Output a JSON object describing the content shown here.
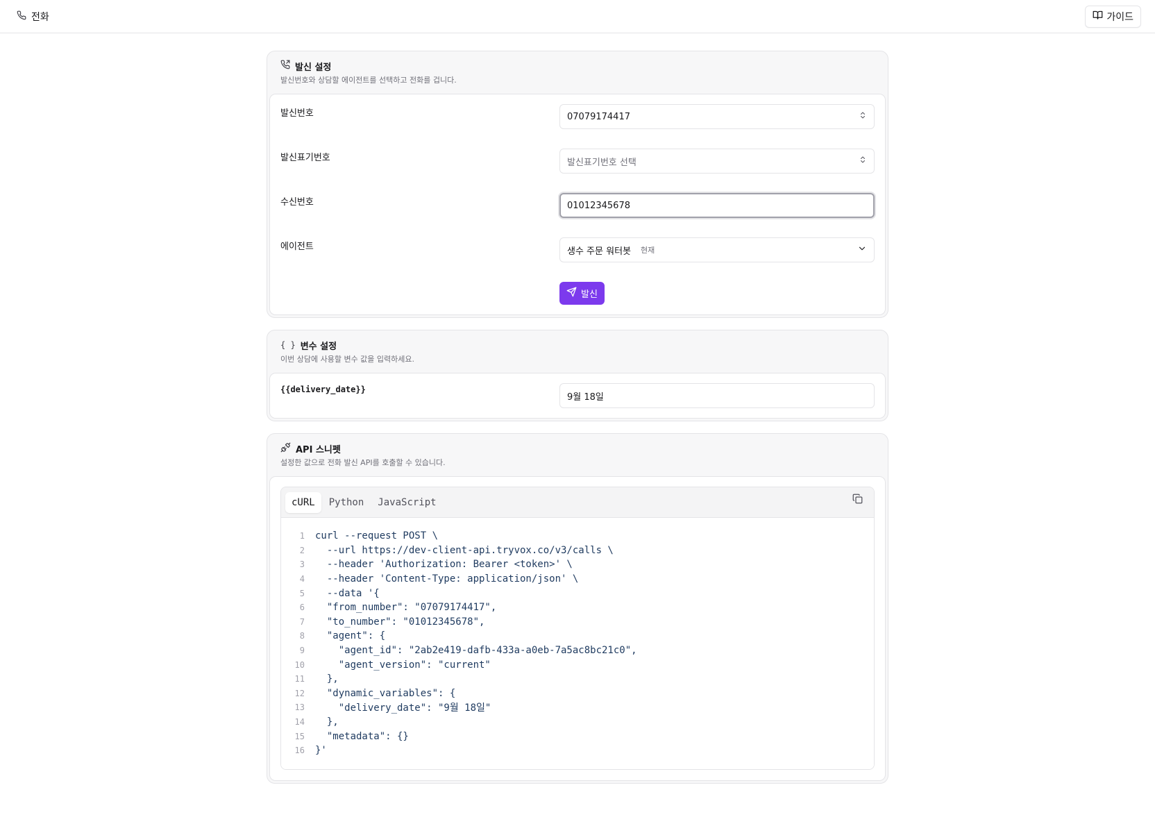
{
  "header": {
    "title": "전화",
    "guide_label": "가이드"
  },
  "outbound": {
    "title": "발신 설정",
    "description": "발신번호와 상담할 에이전트를 선택하고 전화를 겁니다.",
    "fields": {
      "caller_number": {
        "label": "발신번호",
        "value": "07079174417"
      },
      "display_number": {
        "label": "발신표기번호",
        "placeholder": "발신표기번호 선택"
      },
      "recipient_number": {
        "label": "수신번호",
        "value": "01012345678"
      },
      "agent": {
        "label": "에이전트",
        "value": "생수 주문 워터봇",
        "tag": "현재"
      }
    },
    "send_label": "발신"
  },
  "variables": {
    "title": "변수 설정",
    "icon_text": "{ }",
    "description": "이번 상담에 사용할 변수 값을 입력하세요.",
    "items": [
      {
        "name": "{{delivery_date}}",
        "value": "9월 18일"
      }
    ]
  },
  "api": {
    "title": "API 스니펫",
    "description": "설정한 값으로 전화 발신 API를 호출할 수 있습니다.",
    "tabs": [
      "cURL",
      "Python",
      "JavaScript"
    ],
    "active_tab": "cURL",
    "code_lines": [
      "curl --request POST \\",
      "  --url https://dev-client-api.tryvox.co/v3/calls \\",
      "  --header 'Authorization: Bearer <token>' \\",
      "  --header 'Content-Type: application/json' \\",
      "  --data '{",
      "  \"from_number\": \"07079174417\",",
      "  \"to_number\": \"01012345678\",",
      "  \"agent\": {",
      "    \"agent_id\": \"2ab2e419-dafb-433a-a0eb-7a5ac8bc21c0\",",
      "    \"agent_version\": \"current\"",
      "  },",
      "  \"dynamic_variables\": {",
      "    \"delivery_date\": \"9월 18일\"",
      "  },",
      "  \"metadata\": {}",
      "}'"
    ]
  },
  "colors": {
    "accent": "#7c3aed",
    "border": "#e4e4e7",
    "muted_text": "#71717a"
  }
}
